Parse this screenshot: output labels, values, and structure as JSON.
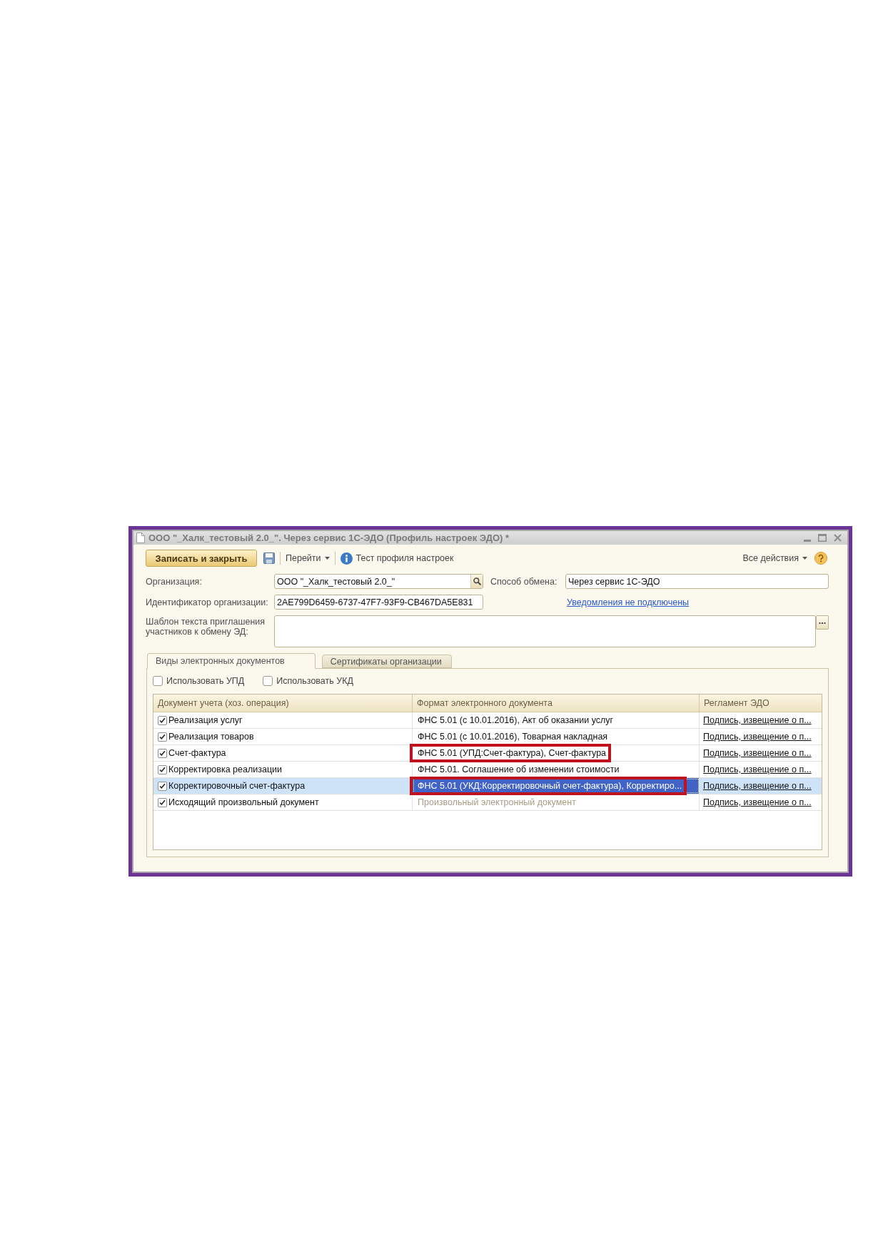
{
  "window": {
    "title": "ООО \"_Халк_тестовый 2.0_\". Через сервис 1С-ЭДО (Профиль настроек ЭДО) *"
  },
  "toolbar": {
    "save_and_close": "Записать и закрыть",
    "go_to": "Перейти",
    "test_profile": "Тест профиля настроек",
    "all_actions": "Все действия"
  },
  "form": {
    "organization": {
      "label": "Организация:",
      "value": "ООО \"_Халк_тестовый 2.0_\""
    },
    "exchange_method": {
      "label": "Способ обмена:",
      "value": "Через сервис 1С-ЭДО"
    },
    "identifier": {
      "label": "Идентификатор организации:",
      "value": "2AE799D6459-6737-47F7-93F9-CB467DA5E831"
    },
    "notifications_link": "Уведомления не подключены",
    "invitation_template": {
      "label": "Шаблон текста приглашения участников к обмену ЭД:",
      "choose_button": "..."
    }
  },
  "tabs": [
    {
      "label": "Виды электронных документов",
      "selected": true
    },
    {
      "label": "Сертификаты организации",
      "selected": false
    }
  ],
  "options": [
    {
      "label": "Использовать УПД",
      "checked": false
    },
    {
      "label": "Использовать УКД",
      "checked": false
    }
  ],
  "table": {
    "columns": [
      "Документ учета (хоз. операция)",
      "Формат электронного документа",
      "Регламент ЭДО"
    ],
    "rows": [
      {
        "checked": true,
        "document": "Реализация услуг",
        "format": "ФНС 5.01 (с 10.01.2016), Акт об оказании услуг",
        "regulation": "Подпись, извещение о п...",
        "selected": false,
        "highlighted": false
      },
      {
        "checked": true,
        "document": "Реализация товаров",
        "format": "ФНС 5.01 (с 10.01.2016), Товарная накладная",
        "regulation": "Подпись, извещение о п...",
        "selected": false,
        "highlighted": false
      },
      {
        "checked": true,
        "document": "Счет-фактура",
        "format": "ФНС 5.01 (УПД:Счет-фактура), Счет-фактура",
        "regulation": "Подпись, извещение о п...",
        "selected": false,
        "highlighted": true
      },
      {
        "checked": true,
        "document": "Корректировка реализации",
        "format": "ФНС 5.01. Соглашение об изменении стоимости",
        "regulation": "Подпись, извещение о п...",
        "selected": false,
        "highlighted": false
      },
      {
        "checked": true,
        "document": "Корректировочный счет-фактура",
        "format": "ФНС 5.01 (УКД:Корректировочный счет-фактура), Корректиро...",
        "regulation": "Подпись, извещение о п...",
        "selected": true,
        "highlighted": true
      },
      {
        "checked": true,
        "document": "Исходящий произвольный документ",
        "format_placeholder": "Произвольный электронный документ",
        "regulation": "Подпись, извещение о п...",
        "selected": false,
        "highlighted": false
      }
    ]
  }
}
